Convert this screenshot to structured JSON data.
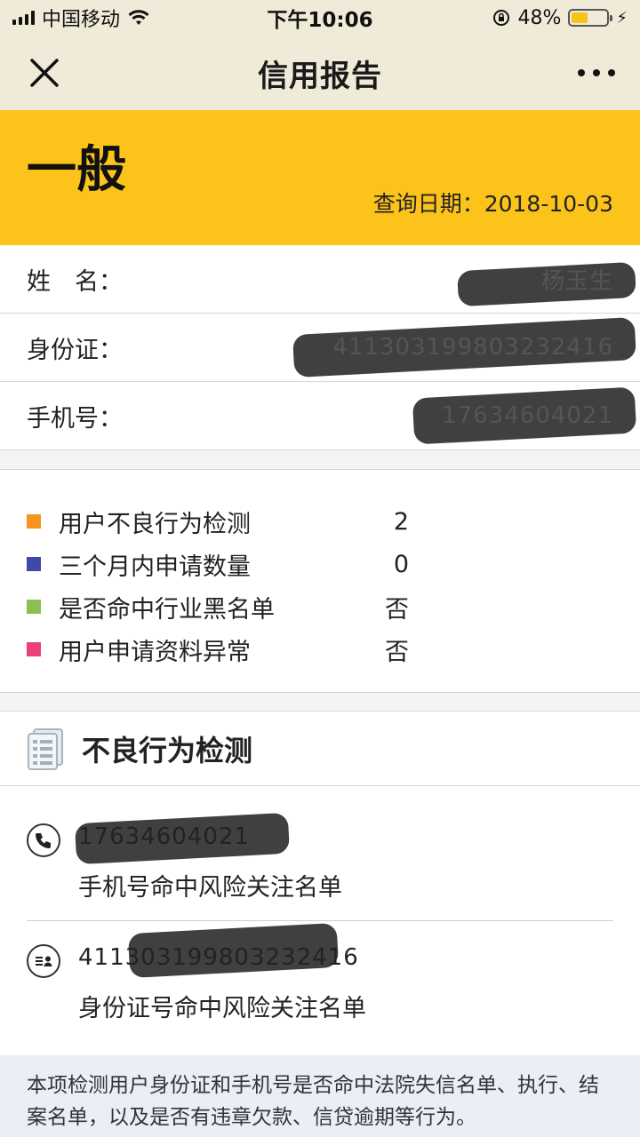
{
  "status_bar": {
    "carrier": "中国移动",
    "time": "下午10:06",
    "battery": "48%",
    "battery_level": 0.48
  },
  "nav": {
    "title": "信用报告",
    "close_icon": "close-icon",
    "more_icon": "more-icon"
  },
  "banner": {
    "level": "一般",
    "date_label": "查询日期：",
    "date_value": "2018-10-03",
    "color": "#fcc31a"
  },
  "identity": {
    "rows": [
      {
        "label": "姓　名：",
        "value": "杨玉生"
      },
      {
        "label": "身份证：",
        "value": "411303199803232416"
      },
      {
        "label": "手机号：",
        "value": "17634604021"
      }
    ]
  },
  "summary": {
    "items": [
      {
        "label": "用户不良行为检测",
        "value": "2",
        "color": "#f7941d"
      },
      {
        "label": "三个月内申请数量",
        "value": "0",
        "color": "#3f4aa8"
      },
      {
        "label": "是否命中行业黑名单",
        "value": "否",
        "color": "#8cc152"
      },
      {
        "label": "用户申请资料异常",
        "value": "否",
        "color": "#ec407a"
      }
    ]
  },
  "detection": {
    "title": "不良行为检测",
    "items": [
      {
        "icon": "phone-icon",
        "value": "17634604021",
        "desc": "手机号命中风险关注名单"
      },
      {
        "icon": "id-card-icon",
        "value": "411303199803232416",
        "desc": "身份证号命中风险关注名单"
      }
    ]
  },
  "footer": {
    "note": "本项检测用户身份证和手机号是否命中法院失信名单、执行、结案名单，以及是否有违章欠款、信贷逾期等行为。"
  }
}
